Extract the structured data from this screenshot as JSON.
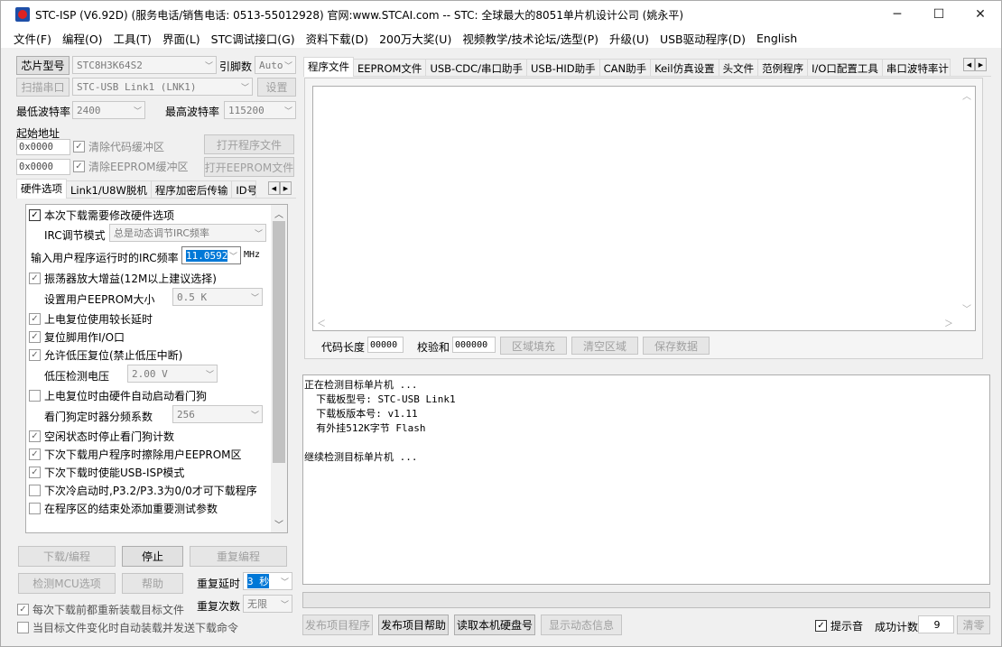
{
  "window": {
    "title": "STC-ISP (V6.92D) (服务电话/销售电话: 0513-55012928) 官网:www.STCAI.com  -- STC: 全球最大的8051单片机设计公司 (姚永平)"
  },
  "window_controls": {
    "minimize": "─",
    "maximize": "☐",
    "close": "✕"
  },
  "menu": [
    "文件(F)",
    "编程(O)",
    "工具(T)",
    "界面(L)",
    "STC调试接口(G)",
    "资料下载(D)",
    "200万大奖(U)",
    "视频教学/技术论坛/选型(P)",
    "升级(U)",
    "USB驱动程序(D)",
    "English"
  ],
  "left": {
    "chip_type_button": "芯片型号",
    "chip_type_value": "STC8H3K64S2",
    "pins_label": "引脚数",
    "pins_value": "Auto",
    "scan_port_button": "扫描串口",
    "port_value": "STC-USB Link1 (LNK1)",
    "settings_button": "设置",
    "min_baud_label": "最低波特率",
    "min_baud_value": "2400",
    "max_baud_label": "最高波特率",
    "max_baud_value": "115200",
    "start_addr_label": "起始地址",
    "code_addr": "0x0000",
    "clear_code_buffer": "清除代码缓冲区",
    "open_program_button": "打开程序文件",
    "eeprom_addr": "0x0000",
    "clear_eeprom_buffer": "清除EEPROM缓冲区",
    "open_eeprom_button": "打开EEPROM文件",
    "tabs": [
      "硬件选项",
      "Link1/U8W脱机",
      "程序加密后传输",
      "ID号"
    ],
    "options": {
      "opt1": "本次下载需要修改硬件选项",
      "irc_mode_label": "IRC调节模式",
      "irc_mode_value": "总是动态调节IRC频率",
      "irc_freq_label": "输入用户程序运行时的IRC频率",
      "irc_freq_value": "11.0592",
      "irc_freq_unit": "MHz",
      "opt_osc": "振荡器放大增益(12M以上建议选择)",
      "eeprom_size_label": "设置用户EEPROM大小",
      "eeprom_size_value": "0.5 K",
      "opt_por_delay": "上电复位使用较长延时",
      "opt_reset_io": "复位脚用作I/O口",
      "opt_lvr": "允许低压复位(禁止低压中断)",
      "lvd_label": "低压检测电压",
      "lvd_value": "2.00 V",
      "opt_wdt": "上电复位时由硬件自动启动看门狗",
      "wdt_div_label": "看门狗定时器分频系数",
      "wdt_div_value": "256",
      "opt_idle_wdt": "空闲状态时停止看门狗计数",
      "opt_erase_eeprom": "下次下载用户程序时擦除用户EEPROM区",
      "opt_usb_isp": "下次下载时使能USB-ISP模式",
      "opt_cold_boot": "下次冷启动时,P3.2/P3.3为0/0才可下载程序",
      "opt_test_params": "在程序区的结束处添加重要测试参数"
    },
    "download_button": "下载/编程",
    "stop_button": "停止",
    "reprogram_button": "重复编程",
    "check_mcu_button": "检测MCU选项",
    "help_button": "帮助",
    "repeat_delay_label": "重复延时",
    "repeat_delay_value": "3 秒",
    "repeat_count_label": "重复次数",
    "repeat_count_value": "无限",
    "reload_before_download": "每次下载前都重新装载目标文件",
    "auto_reload": "当目标文件变化时自动装载并发送下载命令"
  },
  "right": {
    "tabs": [
      "程序文件",
      "EEPROM文件",
      "USB-CDC/串口助手",
      "USB-HID助手",
      "CAN助手",
      "Keil仿真设置",
      "头文件",
      "范例程序",
      "I/O口配置工具",
      "串口波特率计"
    ],
    "code_len_label": "代码长度",
    "code_len_value": "00000",
    "checksum_label": "校验和",
    "checksum_value": "000000",
    "fill_button": "区域填充",
    "clear_button": "清空区域",
    "save_button": "保存数据"
  },
  "log": [
    "正在检测目标单片机 ...",
    "  下载板型号: STC-USB Link1",
    "  下载板版本号: v1.11",
    "  有外挂512K字节 Flash",
    "",
    "继续检测目标单片机 ..."
  ],
  "bottom": {
    "publish_program": "发布项目程序",
    "publish_help": "发布项目帮助",
    "read_disk": "读取本机硬盘号",
    "show_dynamic": "显示动态信息",
    "sound_label": "提示音",
    "success_count_label": "成功计数",
    "success_count_value": "9",
    "clear_count": "清零"
  }
}
